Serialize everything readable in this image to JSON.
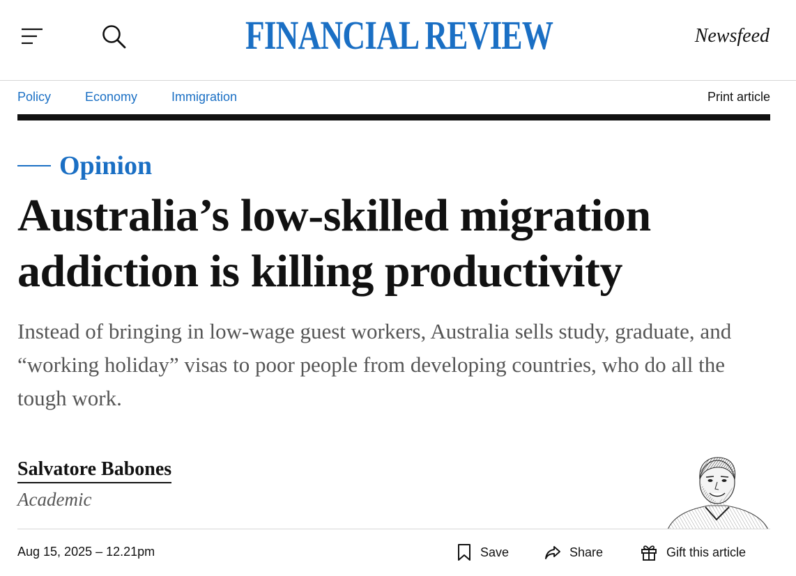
{
  "header": {
    "logo_text": "FINANCIAL REVIEW",
    "newsfeed_label": "Newsfeed",
    "menu_icon": "hamburger-menu-icon",
    "search_icon": "search-icon",
    "brand_color": "#1a6fc4"
  },
  "nav": {
    "items": [
      {
        "label": "Policy"
      },
      {
        "label": "Economy"
      },
      {
        "label": "Immigration"
      }
    ],
    "print_label": "Print article"
  },
  "article": {
    "kicker": "Opinion",
    "headline": "Australia’s low-skilled migration addiction is killing productivity",
    "standfirst": "Instead of bringing in low-wage guest workers, Australia sells study, graduate, and “working holiday” visas to poor people from developing countries, who do all the tough work.",
    "author": {
      "name": "Salvatore Babones",
      "role": "Academic"
    },
    "date": "Aug 15, 2025 – 12.21pm"
  },
  "actions": {
    "save_label": "Save",
    "share_label": "Share",
    "gift_label": "Gift this article",
    "icons": [
      "bookmark-icon",
      "share-arrow-icon",
      "gift-icon"
    ]
  }
}
